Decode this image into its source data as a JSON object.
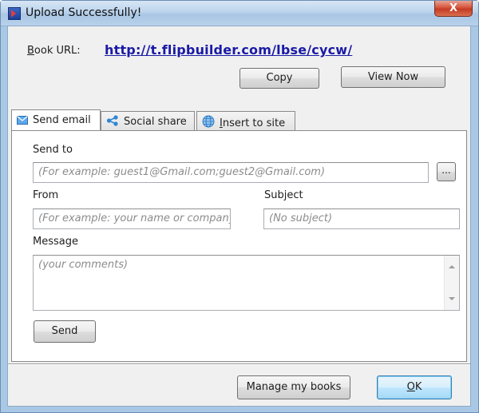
{
  "window": {
    "title": "Upload Successfully!",
    "close_label": "X"
  },
  "book_url": {
    "label": "Book URL:",
    "value": "http://t.flipbuilder.com/lbse/cycw/",
    "copy_label": "Copy",
    "view_now_label": "View Now"
  },
  "tabs": [
    {
      "label": "Send email",
      "icon": "envelope-icon",
      "active": true
    },
    {
      "label": "Social share",
      "icon": "share-icon",
      "active": false
    },
    {
      "label": "Insert to site",
      "icon": "globe-icon",
      "active": false,
      "mnemonic": "I",
      "rest": "nsert to site"
    }
  ],
  "email_form": {
    "send_to_label": "Send to",
    "send_to_placeholder": "(For example: guest1@Gmail.com;guest2@Gmail.com)",
    "browse_label": "...",
    "from_label": "From",
    "from_placeholder": "(For example: your name or company)",
    "subject_label": "Subject",
    "subject_placeholder": "(No subject)",
    "message_label": "Message",
    "message_placeholder": "(your comments)",
    "send_label": "Send"
  },
  "footer": {
    "manage_label": "Manage my books",
    "ok_label": "OK",
    "ok_mnemonic": "O",
    "ok_rest": "K"
  },
  "colors": {
    "link": "#1a1aa6",
    "titlebar": "#bcd4ec",
    "close_button": "#c43b22"
  }
}
